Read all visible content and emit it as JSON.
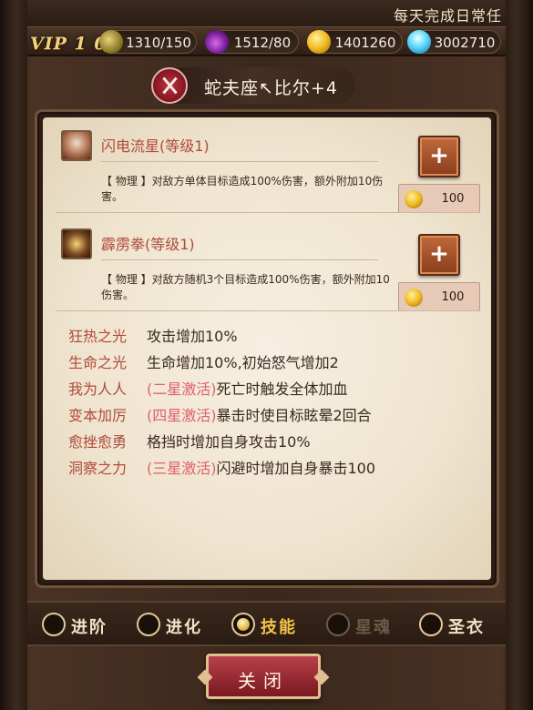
{
  "marquee": {
    "text": "每天完成日常任"
  },
  "resources": {
    "vip": "VIP 1 0",
    "stamina": "1310/150",
    "energy": "1512/80",
    "gold": "1401260",
    "diamond": "3002710"
  },
  "hero": {
    "name": "蛇夫座↖比尔+4"
  },
  "skills": [
    {
      "title": "闪电流星(等级1)",
      "desc": "【 物理 】对敌方单体目标造成100%伤害，额外附加10伤害。",
      "plus": "+",
      "cost": "100"
    },
    {
      "title": "霹雳拳(等级1)",
      "desc": "【 物理 】对敌方随机3个目标造成100%伤害，额外附加10伤害。",
      "plus": "+",
      "cost": "100"
    }
  ],
  "traits": [
    {
      "name": "狂热之光",
      "star": "",
      "desc": "攻击增加10%"
    },
    {
      "name": "生命之光",
      "star": "",
      "desc": "生命增加10%,初始怒气增加2"
    },
    {
      "name": "我为人人",
      "star": "(二星激活)",
      "desc": "死亡时触发全体加血"
    },
    {
      "name": "变本加厉",
      "star": "(四星激活)",
      "desc": "暴击时使目标眩晕2回合"
    },
    {
      "name": "愈挫愈勇",
      "star": "",
      "desc": "格挡时增加自身攻击10%"
    },
    {
      "name": "洞察之力",
      "star": "(三星激活)",
      "desc": "闪避时增加自身暴击100"
    }
  ],
  "tabs": [
    {
      "label": "进阶",
      "state": "normal"
    },
    {
      "label": "进化",
      "state": "normal"
    },
    {
      "label": "技能",
      "state": "active"
    },
    {
      "label": "星魂",
      "state": "disabled"
    },
    {
      "label": "圣衣",
      "state": "normal"
    }
  ],
  "close_label": "关闭"
}
